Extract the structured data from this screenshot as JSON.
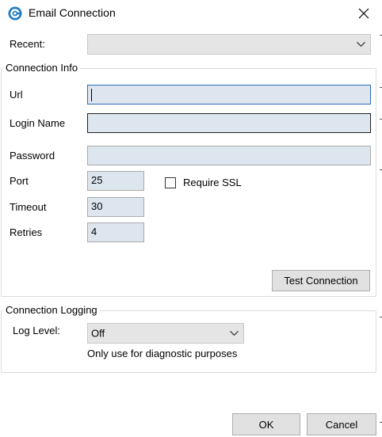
{
  "window": {
    "title": "Email Connection"
  },
  "recent": {
    "label": "Recent:",
    "value": ""
  },
  "connection_info": {
    "legend": "Connection Info",
    "url_label": "Url",
    "url_value": "",
    "login_label": "Login Name",
    "login_value": "",
    "password_label": "Password",
    "password_value": "",
    "port_label": "Port",
    "port_value": "25",
    "require_ssl_label": "Require SSL",
    "require_ssl_checked": false,
    "timeout_label": "Timeout",
    "timeout_value": "30",
    "retries_label": "Retries",
    "retries_value": "4",
    "test_button": "Test Connection"
  },
  "connection_logging": {
    "legend": "Connection Logging",
    "log_level_label": "Log Level:",
    "log_level_value": "Off",
    "hint": "Only use for diagnostic purposes"
  },
  "buttons": {
    "ok": "OK",
    "cancel": "Cancel"
  },
  "icons": {
    "app": "app-logo-icon",
    "close": "close-icon",
    "dropdown": "chevron-down-icon"
  },
  "colors": {
    "accent": "#1f7bc1",
    "field_bg": "#dde6ef",
    "combo_bg": "#e5e5e5"
  }
}
